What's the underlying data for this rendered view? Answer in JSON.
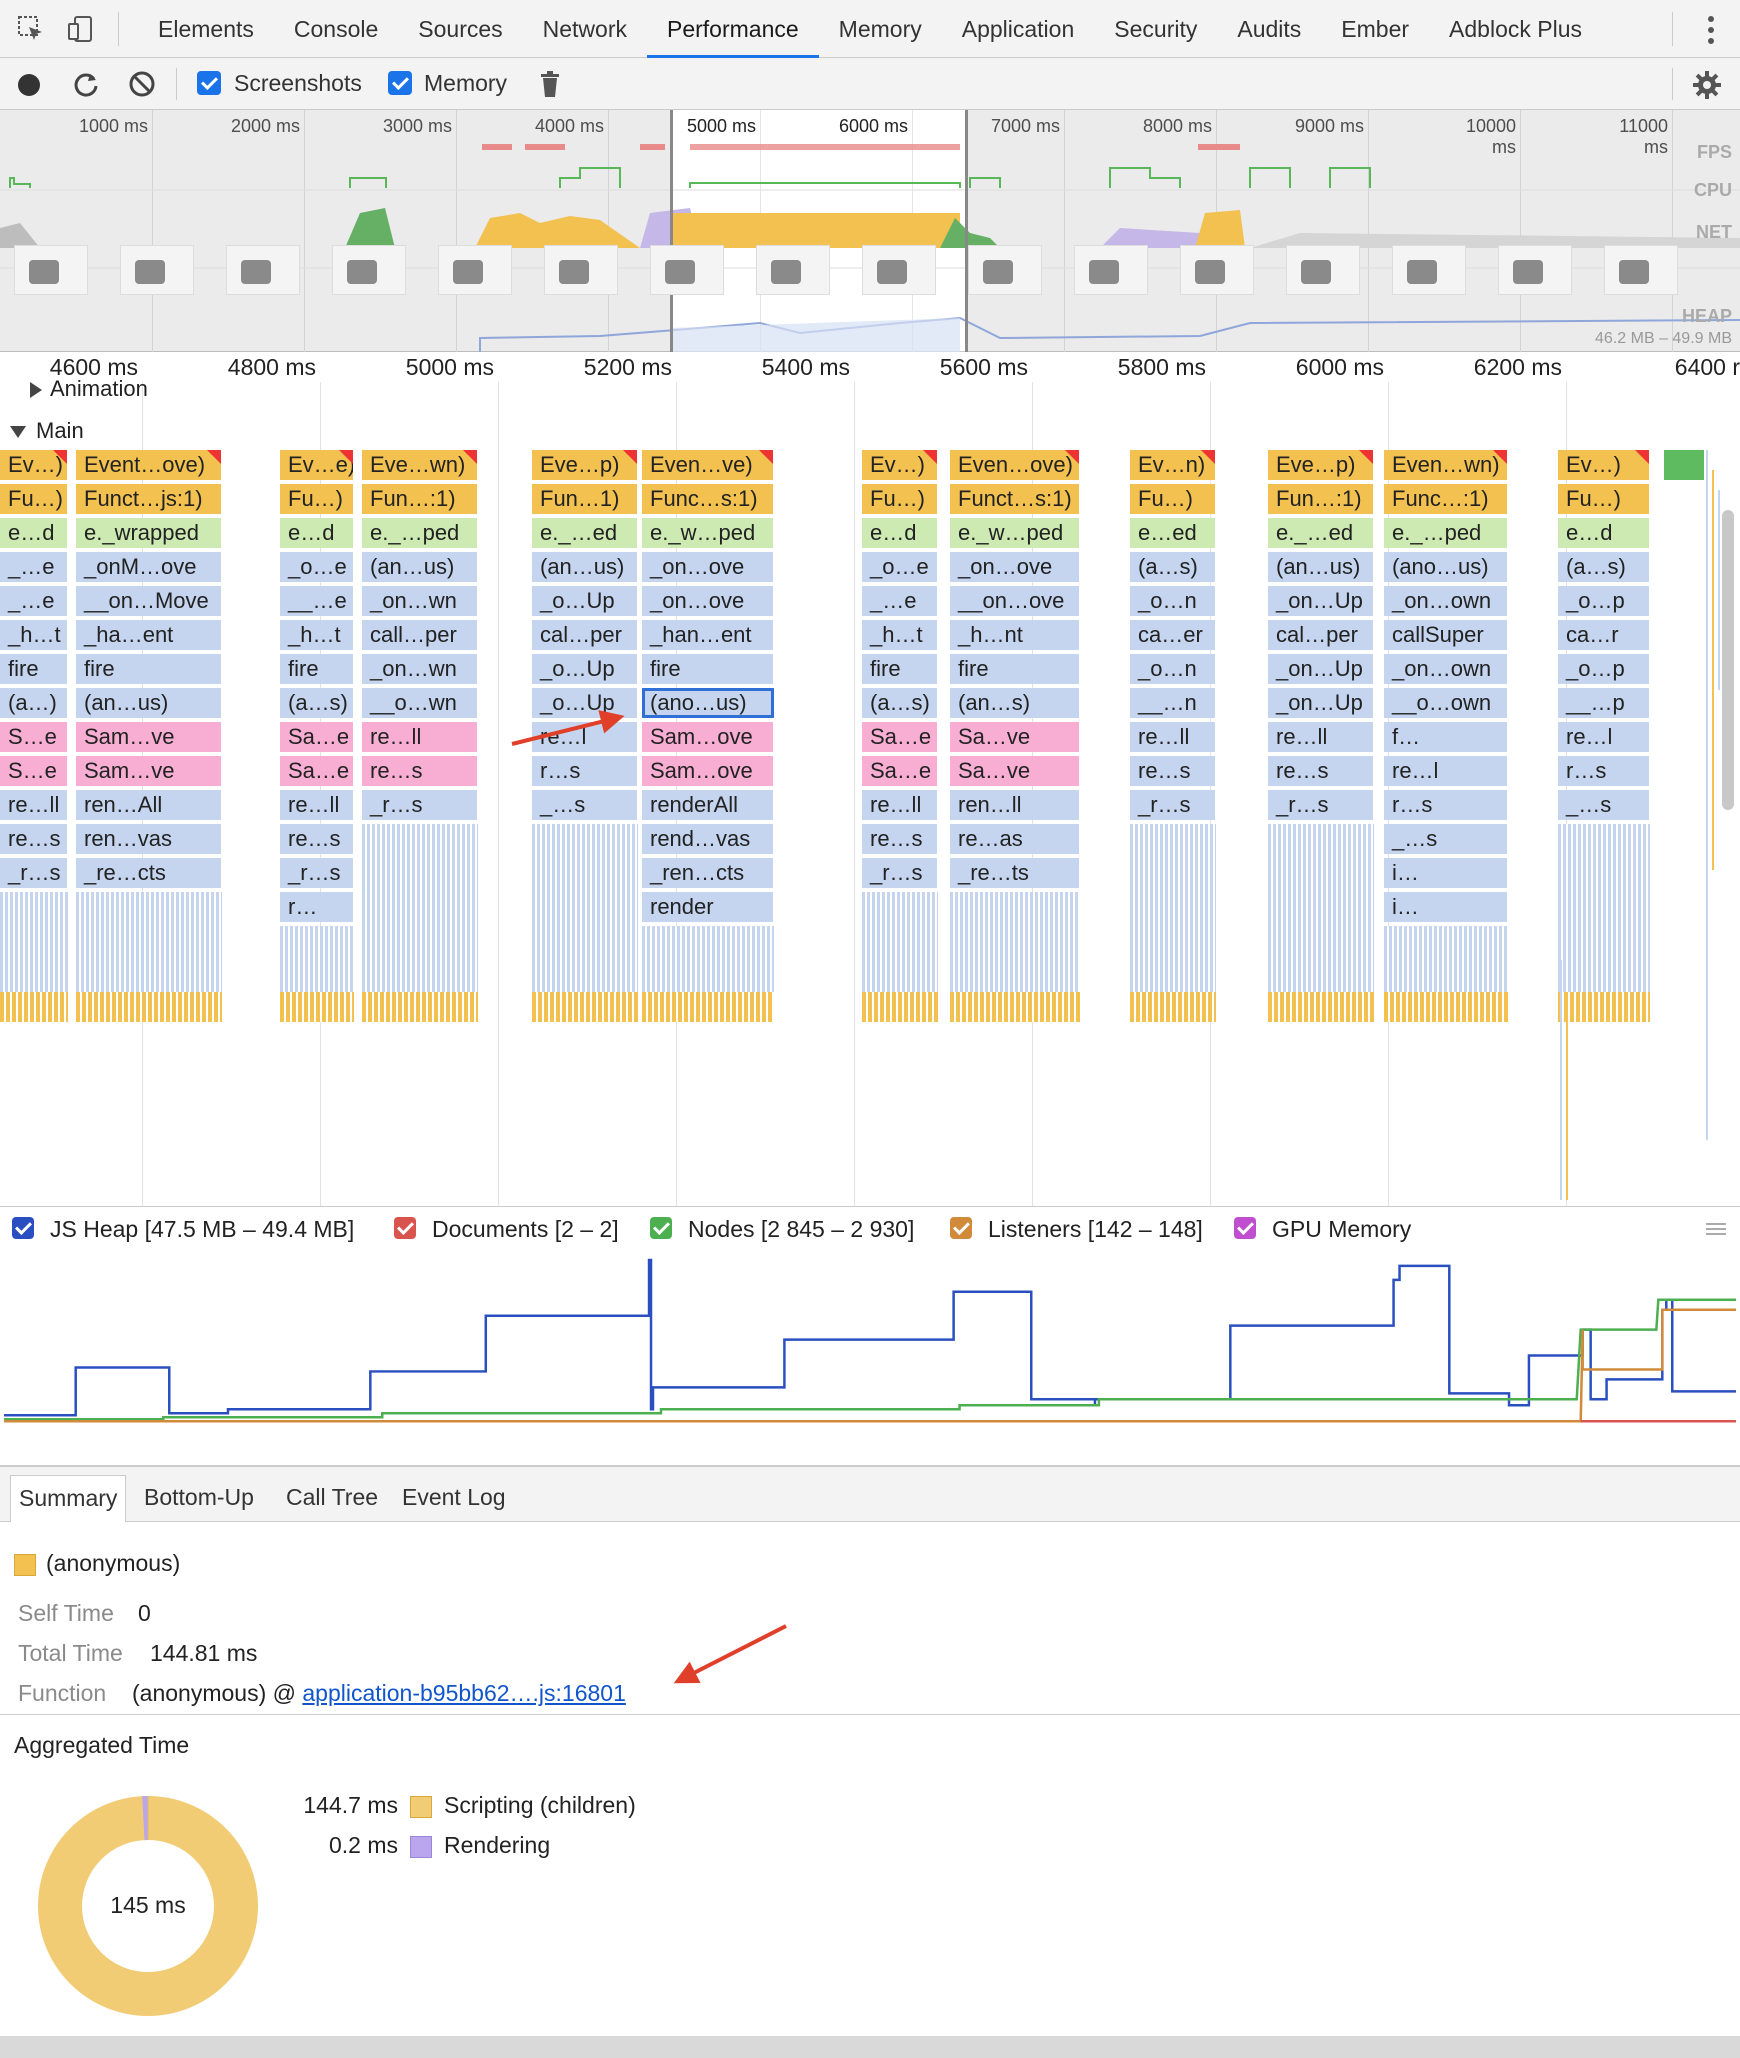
{
  "tabs": [
    "Elements",
    "Console",
    "Sources",
    "Network",
    "Performance",
    "Memory",
    "Application",
    "Security",
    "Audits",
    "Ember",
    "Adblock Plus"
  ],
  "active_tab": "Performance",
  "toolbar": {
    "screenshots_label": "Screenshots",
    "memory_label": "Memory"
  },
  "overview": {
    "ticks": [
      "1000 ms",
      "2000 ms",
      "3000 ms",
      "4000 ms",
      "5000 ms",
      "6000 ms",
      "7000 ms",
      "8000 ms",
      "9000 ms",
      "10000 ms",
      "11000 ms"
    ],
    "labels": {
      "fps": "FPS",
      "cpu": "CPU",
      "net": "NET",
      "heap": "HEAP"
    },
    "heap_range": "46.2 MB – 49.9 MB"
  },
  "ruler_ticks": [
    "4600 ms",
    "4800 ms",
    "5000 ms",
    "5200 ms",
    "5400 ms",
    "5600 ms",
    "5800 ms",
    "6000 ms",
    "6200 ms",
    "6400 r"
  ],
  "tracks": {
    "animation": "Animation",
    "main": "Main"
  },
  "flame_columns": [
    [
      "Ev…)",
      "Fu…)",
      "e…d",
      "_…e",
      "_…e",
      "_h…t",
      "fire",
      "(a…)",
      "S…e",
      "S…e",
      "re…ll",
      "re…s",
      "_r…s"
    ],
    [
      "Event…ove)",
      "Funct…js:1)",
      "e._wrapped",
      "_onM…ove",
      "__on…Move",
      "_ha…ent",
      "fire",
      "(an…us)",
      "Sam…ve",
      "Sam…ve",
      "ren…All",
      "ren…vas",
      "_re…cts"
    ],
    [
      "Ev…e)",
      "Fu…)",
      "e…d",
      "_o…e",
      "__…e",
      "_h…t",
      "fire",
      "(a…s)",
      "Sa…e",
      "Sa…e",
      "re…ll",
      "re…s",
      "_r…s",
      "r…"
    ],
    [
      "Eve…wn)",
      "Fun…:1)",
      "e._…ped",
      "(an…us)",
      "_on…wn",
      "call…per",
      "_on…wn",
      "__o…wn",
      "re…ll",
      "re…s",
      "_r…s"
    ],
    [
      "Eve…p)",
      "Fun…1)",
      "e._…ed",
      "(an…us)",
      "_o…Up",
      "cal…per",
      "_o…Up",
      "_o…Up",
      "re…l",
      "r…s",
      "_…s"
    ],
    [
      "Even…ve)",
      "Func…s:1)",
      "e._w…ped",
      "_on…ove",
      "_on…ove",
      "_han…ent",
      "fire",
      "(ano…us)",
      "Sam…ove",
      "Sam…ove",
      "renderAll",
      "rend…vas",
      "_ren…cts",
      "render"
    ],
    [
      "Ev…)",
      "Fu…)",
      "e…d",
      "_o…e",
      "_…e",
      "_h…t",
      "fire",
      "(a…s)",
      "Sa…e",
      "Sa…e",
      "re…ll",
      "re…s",
      "_r…s"
    ],
    [
      "Even…ove)",
      "Funct…s:1)",
      "e._w…ped",
      "_on…ove",
      "__on…ove",
      "_h…nt",
      "fire",
      "(an…s)",
      "Sa…ve",
      "Sa…ve",
      "ren…ll",
      "re…as",
      "_re…ts"
    ],
    [
      "Ev…n)",
      "Fu…)",
      "e…ed",
      "(a…s)",
      "_o…n",
      "ca…er",
      "_o…n",
      "__…n",
      "re…ll",
      "re…s",
      "_r…s"
    ],
    [
      "Eve…p)",
      "Fun…:1)",
      "e._…ed",
      "(an…us)",
      "_on…Up",
      "cal…per",
      "_on…Up",
      "_on…Up",
      "re…ll",
      "re…s",
      "_r…s"
    ],
    [
      "Even…wn)",
      "Func…:1)",
      "e._…ped",
      "(ano…us)",
      "_on…own",
      "callSuper",
      "_on…own",
      "__o…own",
      "f…",
      "re…l",
      "r…s",
      "_…s",
      "i…",
      "i…"
    ],
    [
      "Ev…)",
      "Fu…)",
      "e…d",
      "(a…s)",
      "_o…p",
      "ca…r",
      "_o…p",
      "__…p",
      "re…l",
      "r…s",
      "_…s"
    ]
  ],
  "counters": {
    "js_heap": "JS Heap [47.5 MB – 49.4 MB]",
    "documents": "Documents [2 – 2]",
    "nodes": "Nodes [2 845 – 2 930]",
    "listeners": "Listeners [142 – 148]",
    "gpu": "GPU Memory"
  },
  "colors": {
    "heap": "#2a4fc0",
    "documents": "#d9534f",
    "nodes": "#4caf50",
    "listeners": "#d08a3a",
    "gpu": "#c04fd0",
    "scripting": "#f2cc75",
    "rendering": "#b9a6ee"
  },
  "bottom_tabs": [
    "Summary",
    "Bottom-Up",
    "Call Tree",
    "Event Log"
  ],
  "summary": {
    "title": "(anonymous)",
    "self_time_label": "Self Time",
    "self_time": "0",
    "total_time_label": "Total Time",
    "total_time": "144.81 ms",
    "function_label": "Function",
    "function_prefix": "(anonymous) @ ",
    "function_link": "application-b95bb62….js:16801",
    "aggregated_title": "Aggregated Time",
    "donut_center": "145 ms",
    "legend": [
      {
        "value": "144.7 ms",
        "label": "Scripting (children)"
      },
      {
        "value": "0.2 ms",
        "label": "Rendering"
      }
    ],
    "scripting_fraction": 0.9986
  }
}
